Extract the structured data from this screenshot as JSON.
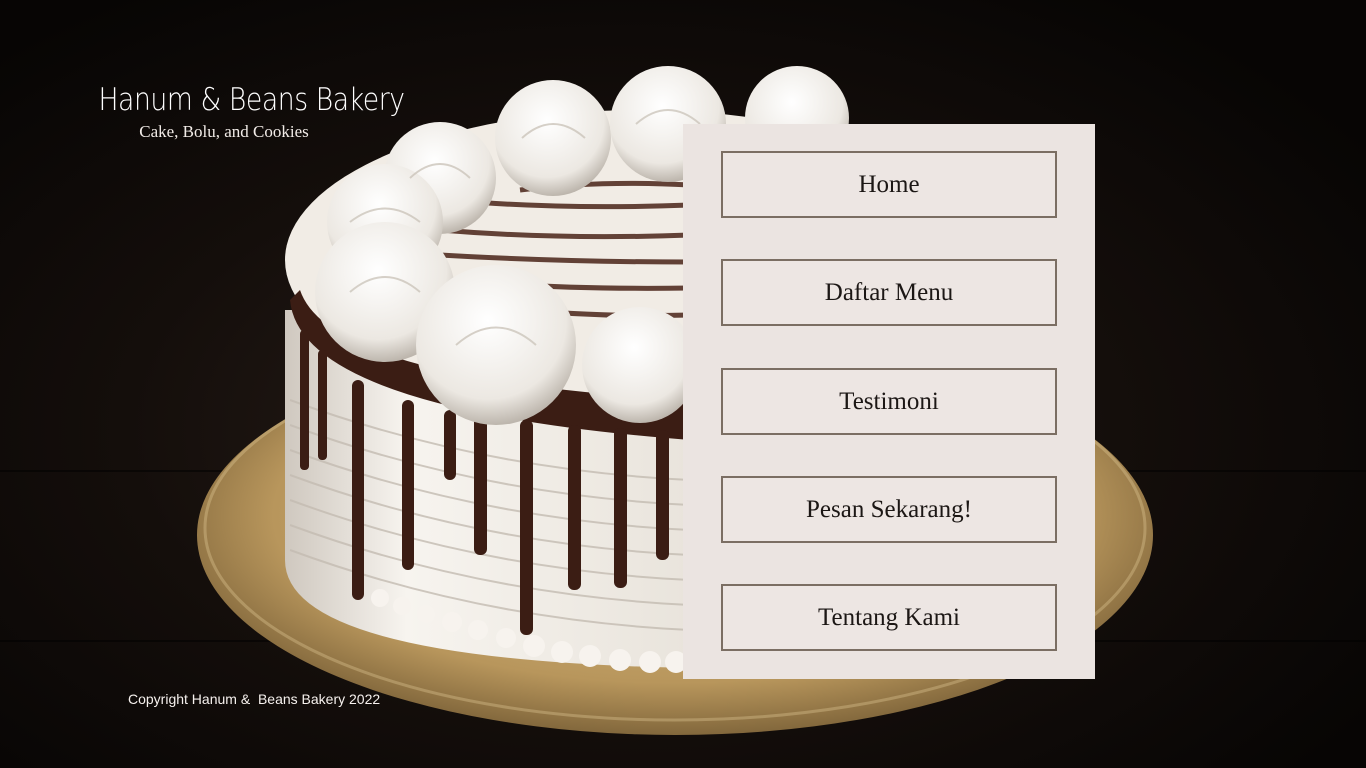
{
  "brand": {
    "title": "Hanum & Beans Bakery",
    "subtitle": "Cake, Bolu, and Cookies"
  },
  "nav": {
    "items": [
      {
        "label": "Home"
      },
      {
        "label": "Daftar Menu"
      },
      {
        "label": "Testimoni"
      },
      {
        "label": "Pesan Sekarang!"
      },
      {
        "label": "Tentang Kami"
      }
    ]
  },
  "footer": {
    "copyright": "Copyright Hanum &  Beans Bakery 2022"
  },
  "colors": {
    "background": "#0d0907",
    "panel": "#ebe4e1",
    "button_border": "#7b6e63",
    "cake_cream": "#f4f0ea",
    "chocolate": "#3b1d14",
    "cake_board": "#c9a96f"
  }
}
